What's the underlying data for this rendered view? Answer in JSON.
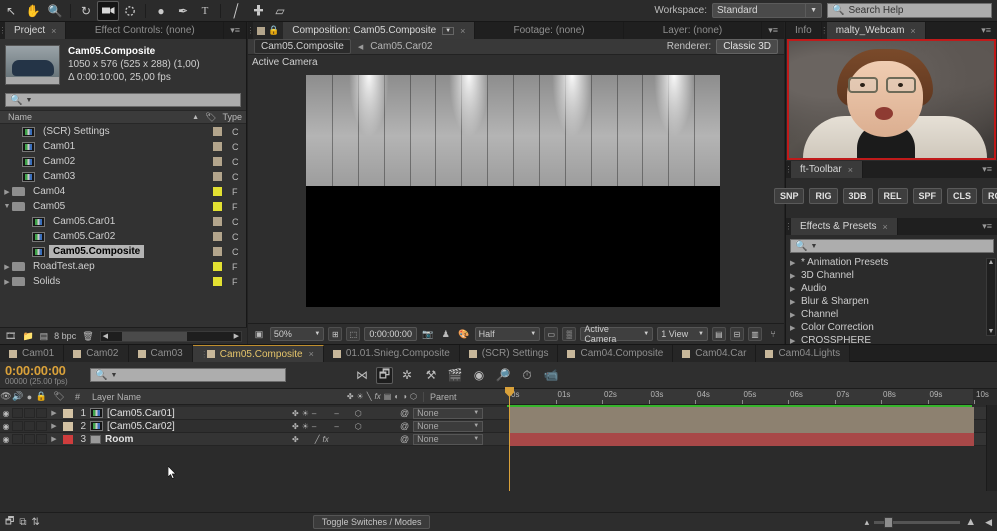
{
  "app": {
    "toolbar_tools": [
      {
        "name": "selection-tool",
        "glyph": "↖",
        "selected": false
      },
      {
        "name": "hand-tool",
        "glyph": "✋",
        "selected": false
      },
      {
        "name": "zoom-tool",
        "glyph": "⚲",
        "selected": false
      },
      {
        "name": "rotation-tool",
        "glyph": "↻",
        "selected": false
      },
      {
        "name": "camera-tool",
        "glyph": "🎥",
        "selected": true
      },
      {
        "name": "pan-behind-tool",
        "glyph": "⌘",
        "selected": false
      },
      {
        "name": "shape-tool",
        "glyph": "●",
        "selected": false
      },
      {
        "name": "pen-tool",
        "glyph": "✒",
        "selected": false
      },
      {
        "name": "text-tool",
        "glyph": "T",
        "selected": false
      },
      {
        "name": "brush-tool",
        "glyph": "╱",
        "selected": false
      },
      {
        "name": "clone-stamp-tool",
        "glyph": "⚓",
        "selected": false
      },
      {
        "name": "eraser-tool",
        "glyph": "▱",
        "selected": false
      }
    ],
    "workspace_label": "Workspace:",
    "workspace_value": "Standard",
    "search_help_placeholder": "Search Help"
  },
  "project": {
    "tabs": [
      {
        "label": "Project",
        "active": true,
        "closeable": true
      },
      {
        "label": "Effect Controls: (none)",
        "active": false,
        "closeable": false
      }
    ],
    "selected_item": {
      "name": "Cam05.Composite",
      "line1": "1050 x 576  (525 x 288) (1,00)",
      "line2": "Δ 0:00:10:00, 25,00 fps"
    },
    "search_placeholder": "",
    "columns": [
      "Name",
      "Type"
    ],
    "items": [
      {
        "label": "(SCR) Settings",
        "icon": "composition-icon",
        "indent": 1,
        "twirl": "",
        "swatch": "#b3a58c",
        "type": "C",
        "selected": false
      },
      {
        "label": "Cam01",
        "icon": "composition-icon",
        "indent": 1,
        "twirl": "",
        "swatch": "#b3a58c",
        "type": "C",
        "selected": false
      },
      {
        "label": "Cam02",
        "icon": "composition-icon",
        "indent": 1,
        "twirl": "",
        "swatch": "#b3a58c",
        "type": "C",
        "selected": false
      },
      {
        "label": "Cam03",
        "icon": "composition-icon",
        "indent": 1,
        "twirl": "",
        "swatch": "#b3a58c",
        "type": "C",
        "selected": false
      },
      {
        "label": "Cam04",
        "icon": "folder-icon",
        "indent": 0,
        "twirl": "▶",
        "swatch": "#e3e132",
        "type": "F",
        "selected": false
      },
      {
        "label": "Cam05",
        "icon": "folder-icon",
        "indent": 0,
        "twirl": "▼",
        "swatch": "#e3e132",
        "type": "F",
        "selected": false
      },
      {
        "label": "Cam05.Car01",
        "icon": "composition-icon",
        "indent": 2,
        "twirl": "",
        "swatch": "#b3a58c",
        "type": "C",
        "selected": false
      },
      {
        "label": "Cam05.Car02",
        "icon": "composition-icon",
        "indent": 2,
        "twirl": "",
        "swatch": "#b3a58c",
        "type": "C",
        "selected": false
      },
      {
        "label": "Cam05.Composite",
        "icon": "composition-icon",
        "indent": 2,
        "twirl": "",
        "swatch": "#b3a58c",
        "type": "C",
        "selected": true
      },
      {
        "label": "RoadTest.aep",
        "icon": "folder-icon",
        "indent": 0,
        "twirl": "▶",
        "swatch": "#e3e132",
        "type": "F",
        "selected": false
      },
      {
        "label": "Solids",
        "icon": "folder-icon",
        "indent": 0,
        "twirl": "▶",
        "swatch": "#e3e132",
        "type": "F",
        "selected": false
      }
    ],
    "footer": {
      "bit_depth": "8 bpc"
    }
  },
  "composition": {
    "tabs": [
      {
        "label": "Composition: Cam05.Composite",
        "active": true,
        "closeable": true
      },
      {
        "label": "Footage: (none)",
        "active": false,
        "closeable": false
      },
      {
        "label": "Layer: (none)",
        "active": false,
        "closeable": false
      }
    ],
    "breadcrumb_active": "Cam05.Composite",
    "breadcrumb_next": "Cam05.Car02",
    "renderer_label": "Renderer:",
    "renderer_value": "Classic 3D",
    "view_label": "Active Camera",
    "bottom_bar": {
      "zoom": "50%",
      "time": "0:00:00:00",
      "resolution": "Half",
      "camera_view": "Active Camera",
      "view_count": "1 View"
    }
  },
  "right_column": {
    "info_tab": "Info",
    "webcam_tab": "malty_Webcam",
    "ft_toolbar_tab": "ft-Toolbar",
    "ft_buttons": [
      "SNP",
      "RIG",
      "3DB",
      "REL",
      "SPF",
      "CLS",
      "ROI"
    ],
    "effects_tab": "Effects & Presets",
    "effects_search_placeholder": "",
    "effects_items": [
      "* Animation Presets",
      "3D Channel",
      "Audio",
      "Blur & Sharpen",
      "Channel",
      "Color Correction",
      "CROSSPHERE"
    ]
  },
  "timeline": {
    "tabs": [
      {
        "label": "Cam01",
        "active": false,
        "closeable": false
      },
      {
        "label": "Cam02",
        "active": false,
        "closeable": false
      },
      {
        "label": "Cam03",
        "active": false,
        "closeable": false
      },
      {
        "label": "Cam05.Composite",
        "active": true,
        "closeable": true
      },
      {
        "label": "01.01.Snieg.Composite",
        "active": false,
        "closeable": false
      },
      {
        "label": "(SCR) Settings",
        "active": false,
        "closeable": false
      },
      {
        "label": "Cam04.Composite",
        "active": false,
        "closeable": false
      },
      {
        "label": "Cam04.Car",
        "active": false,
        "closeable": false
      },
      {
        "label": "Cam04.Lights",
        "active": false,
        "closeable": false
      }
    ],
    "current_time": "0:00:00:00",
    "frame_info": "00000 (25.00 fps)",
    "search_placeholder": "",
    "columns": {
      "layer_name": "Layer Name",
      "parent": "Parent"
    },
    "ruler_ticks": [
      "0s",
      "01s",
      "02s",
      "03s",
      "04s",
      "05s",
      "06s",
      "07s",
      "08s",
      "09s",
      "10s"
    ],
    "layers": [
      {
        "index": "1",
        "name": "[Cam05.Car01]",
        "icon": "composition-icon",
        "color": "#d4c3a4",
        "bar_color": "#8d8170",
        "parent": "None",
        "fx": false
      },
      {
        "index": "2",
        "name": "[Cam05.Car02]",
        "icon": "composition-icon",
        "color": "#d4c3a4",
        "bar_color": "#8d8170",
        "parent": "None",
        "fx": false
      },
      {
        "index": "3",
        "name": "Room",
        "icon": "solid-icon",
        "color": "#cf3d3d",
        "bar_color": "#a84848",
        "parent": "None",
        "fx": true
      }
    ],
    "toggle_button": "Toggle Switches / Modes"
  },
  "colors": {
    "accent_orange": "#d9a13a",
    "webcam_border": "#c01a1a",
    "work_area_green": "#36b52c",
    "tab_active": "#3a3a3a"
  }
}
